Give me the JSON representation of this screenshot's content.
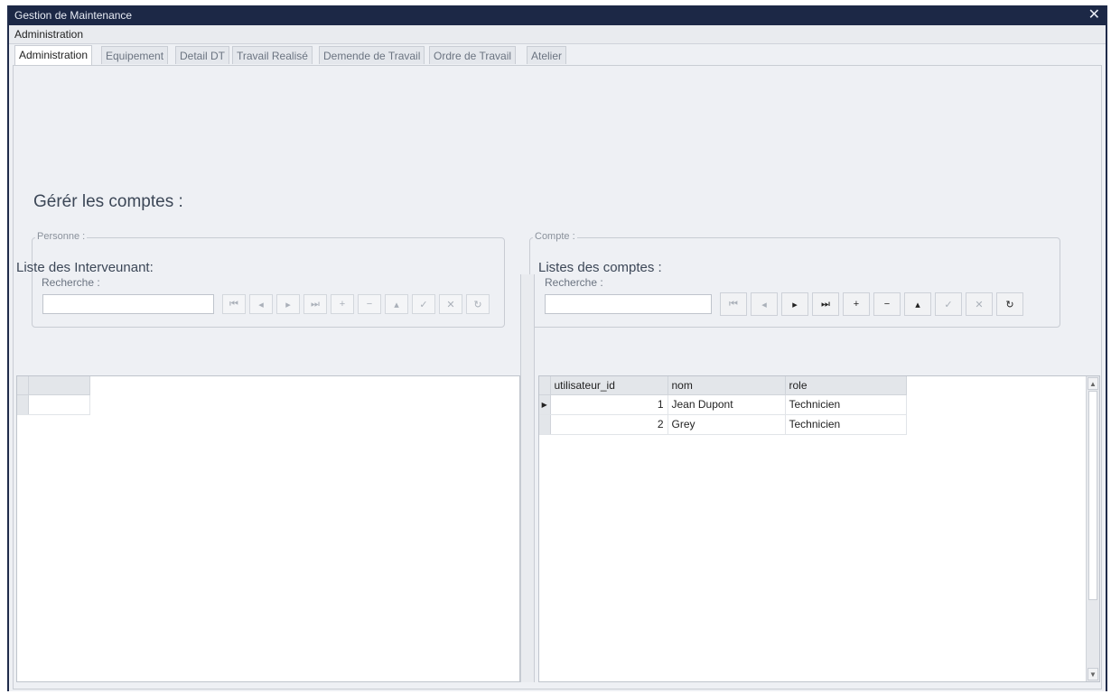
{
  "window": {
    "title": "Gestion de Maintenance",
    "close_glyph": "✕"
  },
  "menu": {
    "items": [
      {
        "label": "Administration"
      }
    ]
  },
  "tabs": [
    {
      "label": "Administration",
      "active": true
    },
    {
      "label": "Equipement",
      "active": false
    },
    {
      "label": "Detail DT",
      "active": false
    },
    {
      "label": "Travail Realisé",
      "active": false
    },
    {
      "label": "Demende de Travail",
      "active": false
    },
    {
      "label": "Ordre de Travail",
      "active": false
    },
    {
      "label": "Atelier",
      "active": false
    }
  ],
  "admin": {
    "heading": "Gérér les comptes :",
    "personne": {
      "legend": "Personne :",
      "search_label": "Recherche :",
      "search_value": ""
    },
    "compte": {
      "legend": "Compte :",
      "search_label": "Recherche :",
      "search_value": ""
    },
    "nav_buttons": [
      {
        "name": "first-record-icon",
        "glyph": "⏮"
      },
      {
        "name": "previous-record-icon",
        "glyph": "◂"
      },
      {
        "name": "next-record-icon",
        "glyph": "▸"
      },
      {
        "name": "last-record-icon",
        "glyph": "⏭"
      },
      {
        "name": "add-record-icon",
        "glyph": "+"
      },
      {
        "name": "delete-record-icon",
        "glyph": "−"
      },
      {
        "name": "move-up-icon",
        "glyph": "▴"
      },
      {
        "name": "save-check-icon",
        "glyph": "✓"
      },
      {
        "name": "cancel-x-icon",
        "glyph": "✕"
      },
      {
        "name": "refresh-icon",
        "glyph": "↻"
      }
    ]
  },
  "left_pane": {
    "title": "Liste des Interveunant:"
  },
  "right_pane": {
    "title": "Listes des comptes :",
    "columns": [
      "utilisateur_id",
      "nom",
      "role"
    ],
    "rows": [
      {
        "utilisateur_id": "1",
        "nom": "Jean Dupont",
        "role": "Technicien"
      },
      {
        "utilisateur_id": "2",
        "nom": "Grey",
        "role": "Technicien"
      }
    ]
  }
}
